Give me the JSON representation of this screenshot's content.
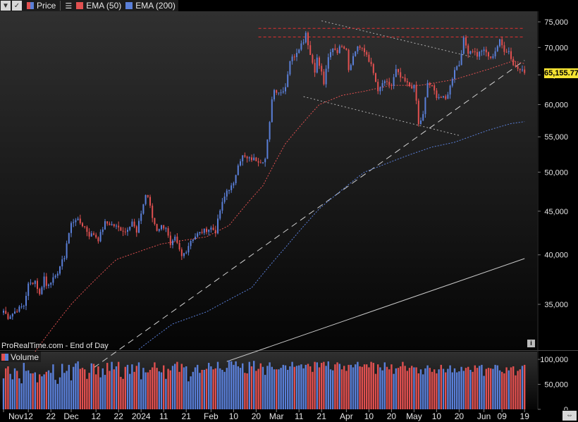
{
  "legend": {
    "price_label": "Price",
    "ema50_label": "EMA (50)",
    "ema200_label": "EMA (200)",
    "colors": {
      "up": "#5a7fd8",
      "down": "#e05050",
      "ema50": "#e05050",
      "ema200": "#5a7fd8"
    }
  },
  "watermark": "ProRealTime.com - End of Day",
  "last_price": "65,155.77",
  "volume_label": "Volume",
  "chart_data": [
    {
      "type": "candlestick",
      "title": "",
      "xlabel": "",
      "ylabel": "",
      "ylim": [
        30000,
        76000
      ],
      "y_ticks": [
        "75,000",
        "70,000",
        "65,000",
        "60,000",
        "55,000",
        "50,000",
        "45,000",
        "40,000",
        "35,000"
      ],
      "y_tick_values": [
        75000,
        70000,
        65000,
        60000,
        55000,
        50000,
        45000,
        40000,
        35000
      ],
      "x_ticks": [
        "Nov",
        "12",
        "22",
        "Dec",
        "12",
        "22",
        "2024",
        "11",
        "21",
        "Feb",
        "10",
        "20",
        "Mar",
        "11",
        "21",
        "Apr",
        "10",
        "20",
        "May",
        "10",
        "20",
        "Jun",
        "09",
        "19"
      ],
      "x_tick_days": [
        0,
        11,
        21,
        30,
        41,
        51,
        61,
        71,
        81,
        92,
        102,
        112,
        121,
        131,
        141,
        152,
        162,
        172,
        182,
        192,
        202,
        213,
        221,
        231
      ],
      "last_day": 231,
      "keypoints": [
        [
          0,
          34400
        ],
        [
          2,
          33800
        ],
        [
          6,
          34500
        ],
        [
          9,
          34900
        ],
        [
          11,
          36900
        ],
        [
          14,
          37300
        ],
        [
          16,
          35900
        ],
        [
          18,
          37700
        ],
        [
          19,
          36800
        ],
        [
          21,
          37300
        ],
        [
          23,
          37600
        ],
        [
          25,
          38800
        ],
        [
          27,
          39800
        ],
        [
          28,
          41300
        ],
        [
          30,
          43500
        ],
        [
          32,
          44100
        ],
        [
          34,
          43600
        ],
        [
          36,
          43100
        ],
        [
          38,
          42200
        ],
        [
          40,
          42300
        ],
        [
          42,
          41700
        ],
        [
          45,
          43600
        ],
        [
          48,
          43400
        ],
        [
          51,
          43000
        ],
        [
          54,
          42600
        ],
        [
          57,
          43800
        ],
        [
          59,
          42400
        ],
        [
          61,
          44800
        ],
        [
          63,
          47000
        ],
        [
          64,
          46800
        ],
        [
          66,
          44200
        ],
        [
          68,
          42800
        ],
        [
          70,
          43200
        ],
        [
          72,
          43100
        ],
        [
          74,
          40900
        ],
        [
          76,
          41800
        ],
        [
          79,
          39800
        ],
        [
          81,
          40500
        ],
        [
          83,
          41600
        ],
        [
          86,
          42300
        ],
        [
          89,
          42700
        ],
        [
          92,
          43000
        ],
        [
          94,
          42600
        ],
        [
          96,
          45100
        ],
        [
          99,
          47600
        ],
        [
          102,
          48300
        ],
        [
          104,
          51200
        ],
        [
          106,
          52200
        ],
        [
          108,
          51800
        ],
        [
          111,
          51800
        ],
        [
          114,
          51500
        ],
        [
          116,
          51800
        ],
        [
          118,
          57000
        ],
        [
          119,
          61100
        ],
        [
          120,
          62400
        ],
        [
          123,
          62000
        ],
        [
          125,
          63000
        ],
        [
          127,
          67600
        ],
        [
          129,
          68500
        ],
        [
          131,
          70000
        ],
        [
          133,
          71300
        ],
        [
          134,
          72900
        ],
        [
          136,
          68600
        ],
        [
          138,
          65800
        ],
        [
          139,
          67900
        ],
        [
          141,
          65400
        ],
        [
          142,
          63500
        ],
        [
          144,
          68000
        ],
        [
          146,
          70000
        ],
        [
          148,
          69300
        ],
        [
          150,
          70500
        ],
        [
          152,
          69800
        ],
        [
          153,
          66000
        ],
        [
          155,
          68300
        ],
        [
          157,
          70300
        ],
        [
          159,
          69500
        ],
        [
          161,
          68700
        ],
        [
          163,
          66600
        ],
        [
          165,
          63800
        ],
        [
          166,
          61900
        ],
        [
          168,
          63600
        ],
        [
          170,
          63500
        ],
        [
          172,
          63100
        ],
        [
          174,
          65800
        ],
        [
          176,
          64500
        ],
        [
          178,
          63800
        ],
        [
          180,
          63100
        ],
        [
          182,
          62900
        ],
        [
          183,
          60600
        ],
        [
          184,
          56800
        ],
        [
          186,
          58300
        ],
        [
          188,
          63600
        ],
        [
          190,
          62900
        ],
        [
          192,
          61400
        ],
        [
          194,
          61200
        ],
        [
          196,
          60800
        ],
        [
          198,
          63000
        ],
        [
          200,
          66100
        ],
        [
          202,
          66900
        ],
        [
          204,
          71500
        ],
        [
          206,
          69200
        ],
        [
          208,
          69500
        ],
        [
          210,
          68500
        ],
        [
          212,
          69500
        ],
        [
          214,
          69000
        ],
        [
          216,
          67800
        ],
        [
          218,
          69400
        ],
        [
          220,
          71200
        ],
        [
          222,
          69500
        ],
        [
          224,
          69300
        ],
        [
          226,
          66800
        ],
        [
          228,
          66200
        ],
        [
          230,
          66300
        ],
        [
          231,
          65155
        ]
      ],
      "ema50_keypoints": [
        [
          14,
          30800
        ],
        [
          30,
          35000
        ],
        [
          50,
          39500
        ],
        [
          70,
          41200
        ],
        [
          90,
          42000
        ],
        [
          100,
          43300
        ],
        [
          110,
          46600
        ],
        [
          115,
          48200
        ],
        [
          125,
          54000
        ],
        [
          140,
          60000
        ],
        [
          150,
          61500
        ],
        [
          160,
          62200
        ],
        [
          172,
          63200
        ],
        [
          185,
          63200
        ],
        [
          200,
          64200
        ],
        [
          215,
          66000
        ],
        [
          226,
          67500
        ],
        [
          231,
          67000
        ]
      ],
      "ema200_keypoints": [
        [
          60,
          31000
        ],
        [
          75,
          33200
        ],
        [
          90,
          34300
        ],
        [
          110,
          36600
        ],
        [
          125,
          40800
        ],
        [
          140,
          45300
        ],
        [
          160,
          50000
        ],
        [
          180,
          52400
        ],
        [
          190,
          53500
        ],
        [
          200,
          54200
        ],
        [
          215,
          56000
        ],
        [
          225,
          57000
        ],
        [
          231,
          57300
        ]
      ],
      "trendlines": [
        {
          "name": "",
          "style": "dashed",
          "color": "#d0d0d0",
          "from": [
            40,
            29500
          ],
          "to": [
            231,
            67600
          ]
        },
        {
          "name": "",
          "style": "solid",
          "color": "#c8c8c8",
          "from": [
            99,
            30000
          ],
          "to": [
            231,
            39600
          ]
        },
        {
          "name": "",
          "style": "dotted",
          "color": "#b0b0b0",
          "from": [
            141,
            75200
          ],
          "to": [
            208,
            68200
          ]
        },
        {
          "name": "",
          "style": "dotted",
          "color": "#b0b0b0",
          "from": [
            133,
            61300
          ],
          "to": [
            202,
            55200
          ]
        },
        {
          "name": "",
          "style": "dashed",
          "color": "#e03030",
          "from": [
            113,
            73700
          ],
          "to": [
            231,
            73700
          ]
        },
        {
          "name": "",
          "style": "dashed",
          "color": "#e03030",
          "from": [
            113,
            72000
          ],
          "to": [
            231,
            72000
          ]
        }
      ]
    },
    {
      "type": "bar",
      "title": "Volume",
      "ylim": [
        0,
        110000
      ],
      "y_ticks": [
        "100,000",
        "50,000",
        "0"
      ],
      "y_tick_values": [
        100000,
        50000,
        0
      ],
      "values": [
        62000,
        82000,
        86000,
        71000,
        60000,
        82000,
        77000,
        62000,
        52000,
        93000,
        77000,
        78000,
        72000,
        72000,
        74000,
        54000,
        70000,
        66000,
        70000,
        75000,
        78000,
        73000,
        90000,
        59000,
        51000,
        64000,
        91000,
        73000,
        77000,
        89000,
        58000,
        85000,
        92000,
        96000,
        81000,
        83000,
        80000,
        61000,
        73000,
        92000,
        91000,
        70000,
        86000,
        64000,
        82000,
        69000,
        93000,
        77000,
        95000,
        80000,
        86000,
        95000,
        65000,
        61000,
        85000,
        89000,
        71000,
        90000,
        75000,
        87000,
        94000,
        60000,
        83000,
        74000,
        74000,
        79000,
        84000,
        94000,
        83000,
        76000,
        74000,
        88000,
        61000,
        81000,
        78000,
        87000,
        91000,
        95000,
        75000,
        91000,
        84000,
        86000,
        56000,
        66000,
        75000,
        84000,
        89000,
        73000,
        79000,
        79000,
        81000,
        93000,
        86000,
        80000,
        82000,
        95000,
        82000,
        79000,
        75000,
        83000,
        98000,
        96000,
        89000,
        96000,
        86000,
        83000,
        92000,
        73000,
        72000,
        95000,
        86000,
        97000,
        77000,
        81000,
        92000,
        85000,
        69000,
        87000,
        94000,
        85000,
        80000,
        80000,
        80000,
        83000,
        89000,
        88000,
        79000,
        86000,
        95000,
        85000,
        87000,
        88000,
        90000,
        82000,
        89000,
        91000,
        86000,
        75000,
        95000,
        94000,
        84000,
        93000,
        95000,
        87000,
        96000,
        80000,
        78000,
        90000,
        94000,
        91000,
        80000,
        87000,
        77000,
        89000,
        89000,
        84000,
        90000,
        95000,
        86000,
        85000,
        90000,
        90000,
        84000,
        95000,
        93000,
        71000,
        90000,
        84000,
        78000,
        94000,
        85000,
        80000,
        90000,
        71000,
        82000,
        83000,
        86000,
        95000,
        87000,
        77000,
        83000,
        87000,
        84000,
        84000,
        72000,
        80000,
        70000,
        82000,
        88000,
        83000,
        75000,
        80000,
        72000,
        80000,
        89000,
        81000,
        74000,
        81000,
        88000,
        74000,
        82000,
        74000,
        76000,
        85000,
        77000,
        83000,
        85000,
        79000,
        75000,
        88000,
        83000,
        87000,
        89000,
        67000,
        81000,
        83000,
        82000,
        81000,
        89000,
        88000,
        78000,
        75000,
        72000,
        84000,
        78000,
        84000,
        86000,
        68000,
        77000,
        80000,
        87000,
        89000
      ]
    }
  ]
}
